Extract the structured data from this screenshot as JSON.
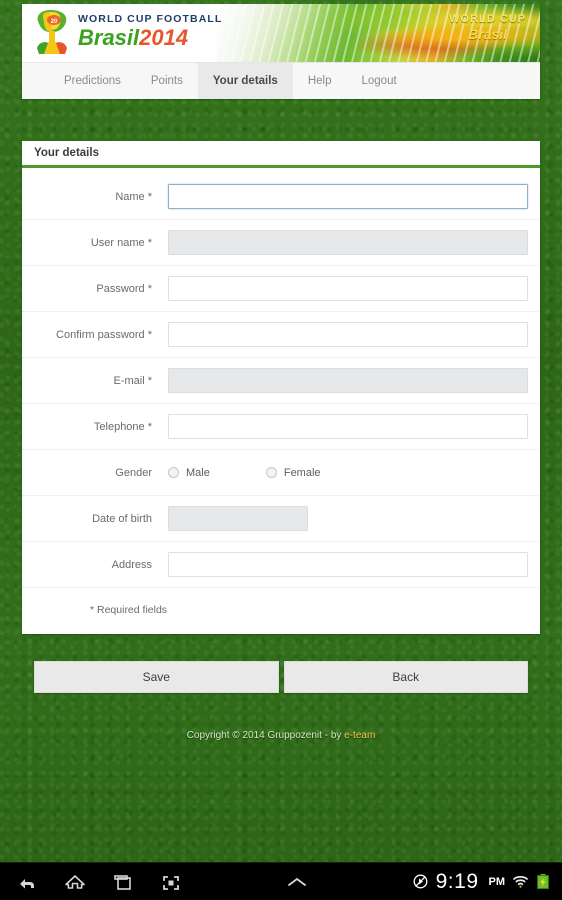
{
  "banner": {
    "logo_icon": "world-cup-trophy-icon",
    "wordmark_line1": "WORLD CUP FOOTBALL",
    "wordmark_brasil": "Brasil",
    "wordmark_year": "2014",
    "art_text_line1": "WORLD CUP",
    "art_text_line2": "Brasil"
  },
  "nav": {
    "items": [
      {
        "label": "Predictions",
        "active": false
      },
      {
        "label": "Points",
        "active": false
      },
      {
        "label": "Your details",
        "active": true
      },
      {
        "label": "Help",
        "active": false
      },
      {
        "label": "Logout",
        "active": false
      }
    ]
  },
  "form": {
    "title": "Your details",
    "required_note": "* Required fields",
    "fields": [
      {
        "label": "Name *",
        "value": "",
        "placeholder": "",
        "state": "focused",
        "type": "text",
        "name": "name"
      },
      {
        "label": "User name *",
        "value": "",
        "placeholder": "",
        "state": "disabled",
        "type": "text",
        "name": "username"
      },
      {
        "label": "Password *",
        "value": "",
        "placeholder": "",
        "state": "normal",
        "type": "password",
        "name": "password"
      },
      {
        "label": "Confirm password *",
        "value": "",
        "placeholder": "",
        "state": "normal",
        "type": "password",
        "name": "confirm-password"
      },
      {
        "label": "E-mail *",
        "value": "",
        "placeholder": "",
        "state": "disabled",
        "type": "email",
        "name": "email"
      },
      {
        "label": "Telephone *",
        "value": "",
        "placeholder": "",
        "state": "normal",
        "type": "text",
        "name": "telephone"
      }
    ],
    "gender": {
      "label": "Gender",
      "options": [
        {
          "label": "Male",
          "selected": false
        },
        {
          "label": "Female",
          "selected": false
        }
      ]
    },
    "date_of_birth": {
      "label": "Date of birth",
      "value": "",
      "placeholder": "",
      "state": "disabled"
    },
    "address": {
      "label": "Address",
      "value": "",
      "placeholder": "",
      "state": "normal"
    }
  },
  "actions": {
    "save_label": "Save",
    "back_label": "Back"
  },
  "footer": {
    "text": "Copyright © 2014 Gruppozenit - by ",
    "link_label": "e-team"
  },
  "system_bar": {
    "back_icon": "back-arrow-icon",
    "home_icon": "home-icon",
    "recents_icon": "recent-apps-icon",
    "screenshot_icon": "screenshot-icon",
    "expand_icon": "chevron-up-icon",
    "mute_icon": "mute-icon",
    "time": "9:19",
    "ampm": "PM",
    "wifi_icon": "wifi-icon",
    "battery_icon": "battery-charging-icon"
  },
  "colors": {
    "grass_green": "#2f6a17",
    "accent_green": "#4c9a2a",
    "brasil_green": "#3aa21d",
    "year_orange": "#e8552a",
    "link_gold": "#f2c84b",
    "focus_border": "#8fb0c4",
    "disabled_bg": "#e7e8ea"
  }
}
